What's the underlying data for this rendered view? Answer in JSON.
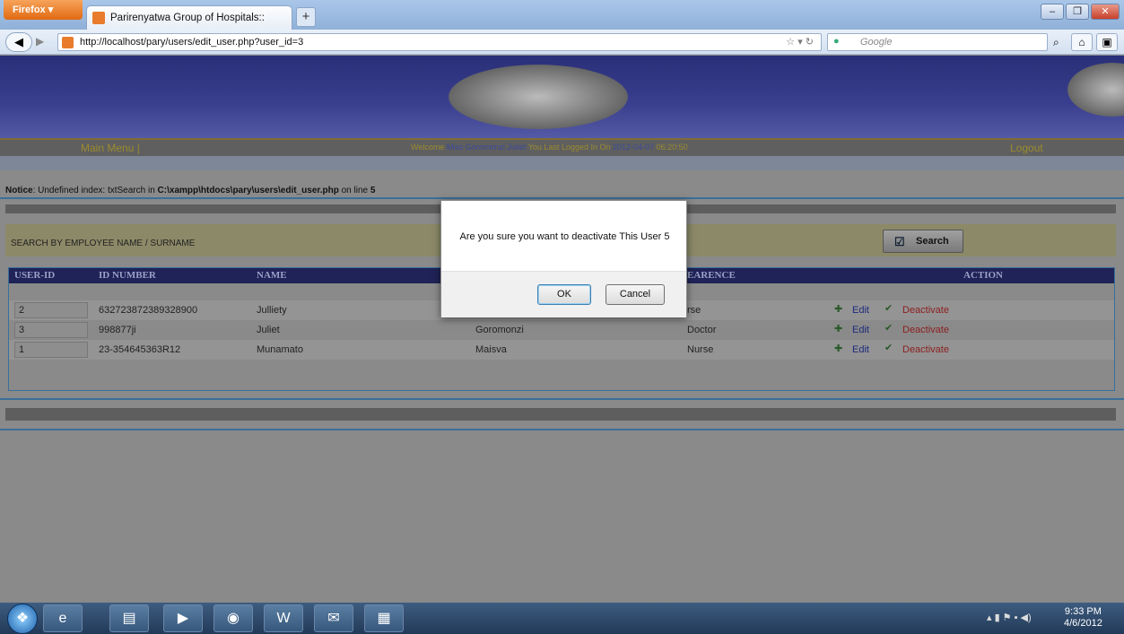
{
  "browser": {
    "menu_button": "Firefox",
    "tab_title": "Parirenyatwa Group of Hospitals::",
    "new_tab": "+",
    "url": "http://localhost/pary/users/edit_user.php?user_id=3",
    "search_placeholder": "Google",
    "window_controls": {
      "minimize": "–",
      "maximize": "❐",
      "close": "✕"
    }
  },
  "header": {
    "main_menu": "Main Menu |",
    "welcome_prefix": "Welcome",
    "user_name": "Miss Goromonzi Juliet",
    "last_login_label": "You Last Logged In On",
    "last_login_date": "2012-04-07",
    "last_login_time": "06:20:50",
    "logout": "Logout"
  },
  "notice": {
    "label": "Notice",
    "text": ": Undefined index: txtSearch in ",
    "path": "C:\\xampp\\htdocs\\pary\\users\\edit_user.php",
    "line_text": " on line ",
    "line": "5"
  },
  "search": {
    "label": "SEARCH BY EMPLOYEE NAME / SURNAME",
    "button": "Search"
  },
  "table": {
    "headers": {
      "user_id": "USER-ID",
      "id_number": "ID NUMBER",
      "name": "NAME",
      "clearance": "EARENCE",
      "action": "ACTION"
    },
    "rows": [
      {
        "user_id": "2",
        "id_number": "632723872389328900",
        "name": "Julliety",
        "surname": "",
        "clearance": "rse",
        "edit": "Edit",
        "deactivate": "Deactivate"
      },
      {
        "user_id": "3",
        "id_number": "998877ji",
        "name": "Juliet",
        "surname": "Goromonzi",
        "clearance": "Doctor",
        "edit": "Edit",
        "deactivate": "Deactivate"
      },
      {
        "user_id": "1",
        "id_number": "23-354645363R12",
        "name": "Munamato",
        "surname": "Maisva",
        "clearance": "Nurse",
        "edit": "Edit",
        "deactivate": "Deactivate"
      }
    ]
  },
  "dialog": {
    "message": "Are you sure you want to deactivate  This User 5",
    "ok": "OK",
    "cancel": "Cancel"
  },
  "taskbar": {
    "time": "9:33 PM",
    "date": "4/6/2012"
  }
}
